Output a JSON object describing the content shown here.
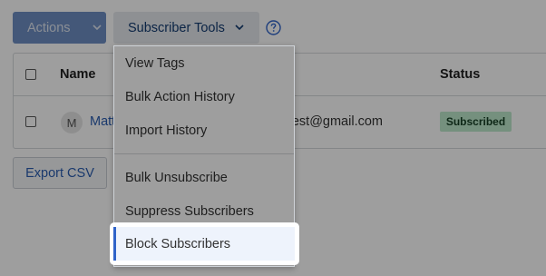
{
  "toolbar": {
    "actions_label": "Actions",
    "subscriber_tools_label": "Subscriber Tools"
  },
  "icons": {
    "chevron": "chevron-down-icon",
    "help": "question-circle-icon"
  },
  "table": {
    "columns": {
      "name": "Name",
      "status": "Status"
    },
    "rows": [
      {
        "avatar_initial": "M",
        "name": "Matt",
        "email_partial": "rtest@gmail.com",
        "status": "Subscribed"
      }
    ]
  },
  "export_label": "Export CSV",
  "menu": {
    "group1": [
      "View Tags",
      "Bulk Action History",
      "Import History"
    ],
    "group2": [
      "Bulk Unsubscribe",
      "Suppress Subscribers"
    ],
    "highlighted": "Block Subscribers"
  },
  "colors": {
    "primary": "#6e8fc4",
    "link": "#2a5db0",
    "subscribed_badge": "#bde8cc",
    "highlight_bar": "#2f63c9"
  }
}
